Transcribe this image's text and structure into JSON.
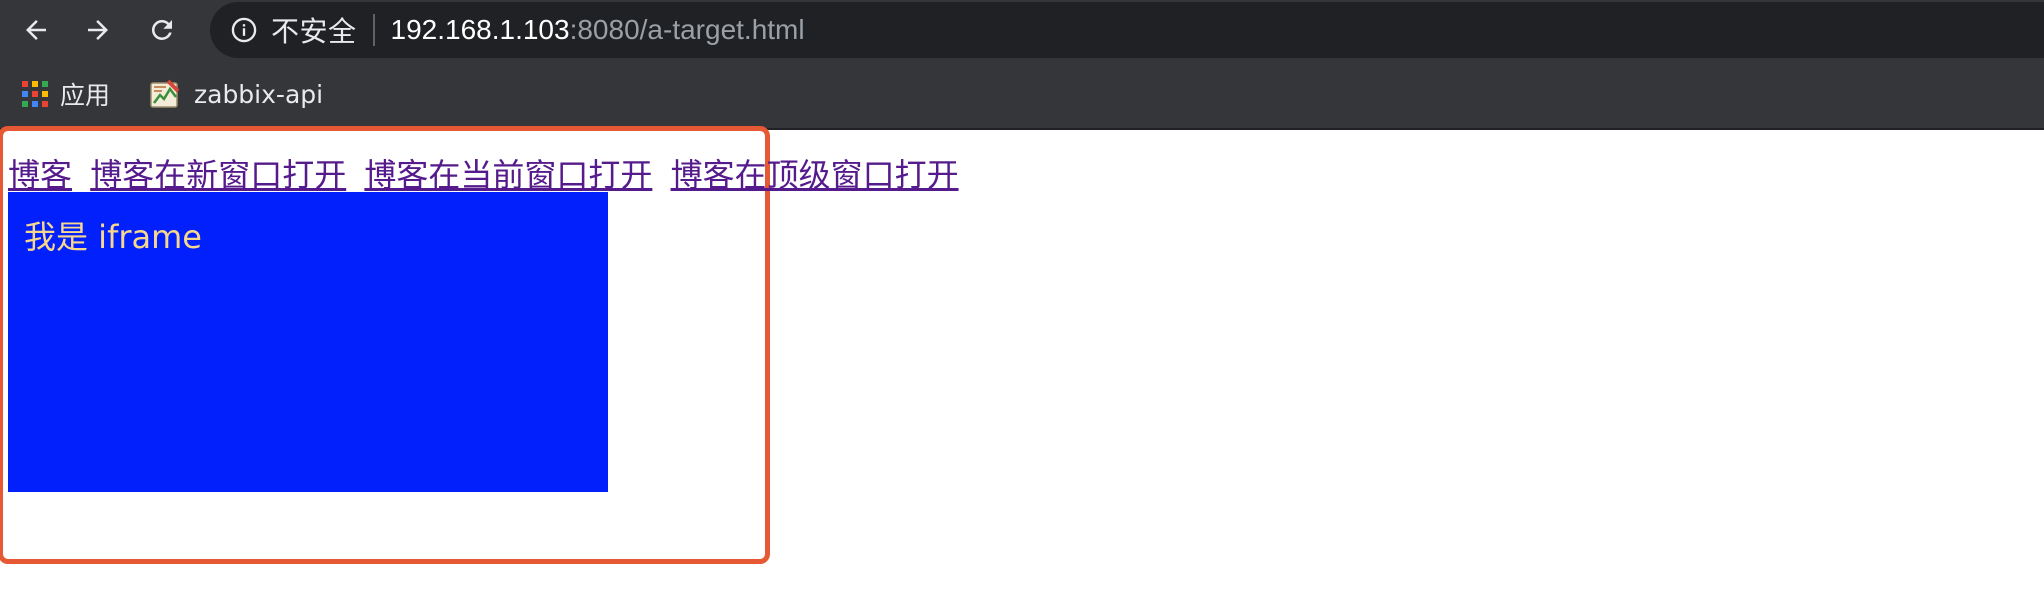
{
  "toolbar": {
    "back_icon": "arrow-left-icon",
    "forward_icon": "arrow-right-icon",
    "reload_icon": "reload-icon",
    "security_icon": "info-icon",
    "security_label": "不安全",
    "url_host": "192.168.1.103",
    "url_rest": ":8080/a-target.html"
  },
  "bookmarks": [
    {
      "label": "应用",
      "icon": "apps-grid-icon"
    },
    {
      "label": "zabbix-api",
      "icon": "zabbix-favicon"
    }
  ],
  "page": {
    "links": [
      "博客",
      "博客在新窗口打开",
      "博客在当前窗口打开",
      "博客在顶级窗口打开"
    ],
    "iframe_text": "我是 iframe"
  },
  "colors": {
    "toolbar_bg": "#35363a",
    "omnibox_bg": "#202124",
    "link_visited": "#551a8b",
    "iframe_bg": "#0220fb",
    "iframe_text": "#f7d78c",
    "highlight_border": "#e55a35"
  }
}
